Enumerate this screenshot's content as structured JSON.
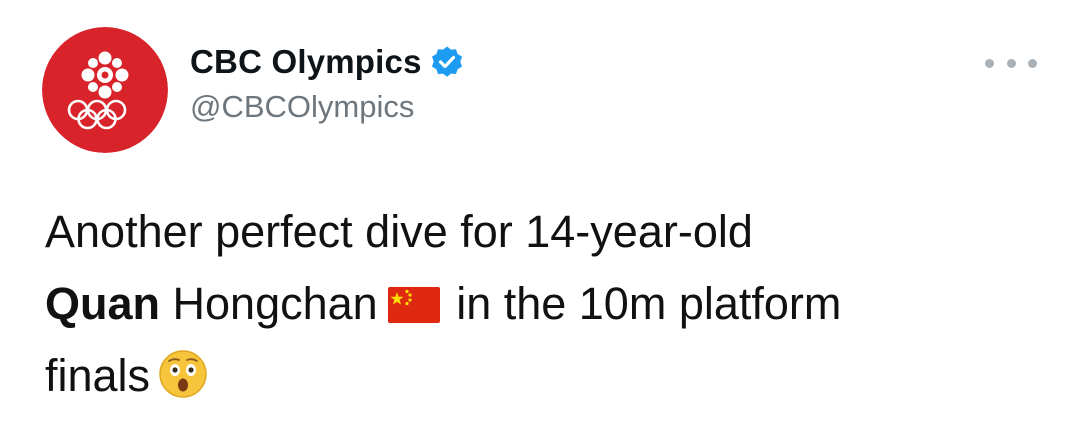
{
  "tweet": {
    "author": {
      "display_name": "CBC Olympics",
      "handle": "@CBCOlympics",
      "verified": true,
      "avatar_icon": "cbc-olympics-logo-icon",
      "avatar_color": "#d8232a"
    },
    "more_icon": "more-options-icon",
    "text": {
      "line1": "Another perfect dive for 14-year-old",
      "name_bold": "Quan",
      "name_rest": " Hongchan",
      "flag_icon": "china-flag-emoji",
      "line2_rest": " in the 10m platform",
      "line3": "finals",
      "emoji_icon": "astonished-face-emoji"
    },
    "colors": {
      "verified_badge": "#1d9bf0",
      "handle": "#6e767d",
      "flag_red": "#de2910",
      "flag_star": "#ffde00"
    }
  }
}
